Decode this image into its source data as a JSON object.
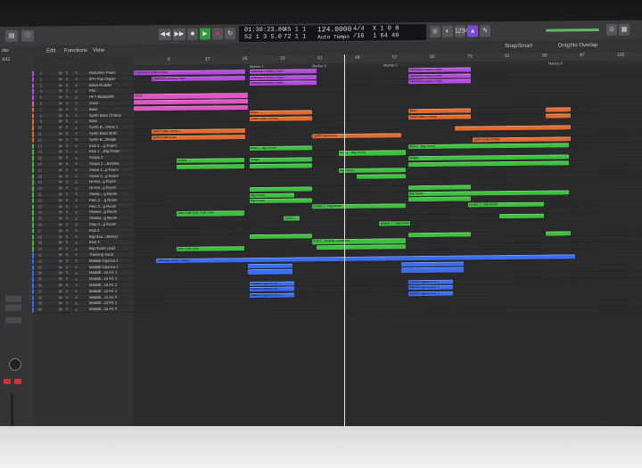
{
  "control_bar": {
    "position_time": "01:38:23.86",
    "position_bars": "52 1 3 5.0",
    "smpte_a": "45 1 1",
    "smpte_b": "72 1 1",
    "tempo": "124.0000",
    "tempo_mode": "Auto Tempo",
    "signature": "4/4",
    "division": "/16",
    "cpu": "X 1 0 0",
    "ending": "1 64 49"
  },
  "menu": {
    "edit": "Edit",
    "functions": "Functions",
    "view": "View",
    "snap_label": "Snap:",
    "snap_value": "Smart",
    "drag_label": "Drag:",
    "drag_value": "No Overlap",
    "inspector_count": "1/11",
    "inspector_label": "dits"
  },
  "ruler_ticks": [
    "9",
    "17",
    "25",
    "33",
    "41",
    "49",
    "57",
    "65",
    "73",
    "81",
    "89",
    "97",
    "105"
  ],
  "markers": [
    "Marker 1",
    "Marker 3",
    "Marker 5",
    "Marker 6"
  ],
  "tracks": [
    {
      "num": "1",
      "name": "Distortion Piano",
      "color": "#b44adf"
    },
    {
      "num": "2",
      "name": "80's Pop Organ",
      "color": "#b44adf"
    },
    {
      "num": "3",
      "name": "Black Rudder",
      "color": "#b44adf"
    },
    {
      "num": "4",
      "name": "Pan",
      "color": "#b44adf"
    },
    {
      "num": "5",
      "name": "HFY Bladsmith",
      "color": "#b44adf"
    },
    {
      "num": "6",
      "name": "Voice",
      "color": "#e055c6"
    },
    {
      "num": "7",
      "name": "Bass",
      "color": "#e36a2e"
    },
    {
      "num": "8",
      "name": "Synth Bass Chorus",
      "color": "#e36a2e"
    },
    {
      "num": "9",
      "name": "Bass",
      "color": "#e36a2e"
    },
    {
      "num": "10",
      "name": "Synth B...Verse 1",
      "color": "#e36a2e"
    },
    {
      "num": "11",
      "name": "Synth Bass BUB",
      "color": "#e36a2e"
    },
    {
      "num": "12",
      "name": "Synth B...Bridge",
      "color": "#e36a2e"
    },
    {
      "num": "13",
      "name": "Kick 2 ...g Room",
      "color": "#3fbf3f"
    },
    {
      "num": "14",
      "name": "Kick 1 ...Big Room",
      "color": "#3fbf3f"
    },
    {
      "num": "15",
      "name": "Snaps 2",
      "color": "#3fbf3f"
    },
    {
      "num": "16",
      "name": "Snaps 1 ...berlake",
      "color": "#3fbf3f"
    },
    {
      "num": "17",
      "name": "Snare 1...g Room",
      "color": "#3fbf3f"
    },
    {
      "num": "18",
      "name": "Snare 2...g Room",
      "color": "#3fbf3f"
    },
    {
      "num": "19",
      "name": "Hi-Hat...g Room",
      "color": "#3fbf3f"
    },
    {
      "num": "20",
      "name": "Hi-Hat...g Room",
      "color": "#3fbf3f"
    },
    {
      "num": "21",
      "name": "Steely-...g Room",
      "color": "#3fbf3f"
    },
    {
      "num": "22",
      "name": "Perc 1 ...g Room",
      "color": "#3fbf3f"
    },
    {
      "num": "23",
      "name": "Perc 2...g Room",
      "color": "#3fbf3f"
    },
    {
      "num": "24",
      "name": "Shaker...g Room",
      "color": "#3fbf3f"
    },
    {
      "num": "25",
      "name": "Shaker...g Room",
      "color": "#3fbf3f"
    },
    {
      "num": "26",
      "name": "Clap 2...g Room",
      "color": "#3fbf3f"
    },
    {
      "num": "27",
      "name": "Kick 2",
      "color": "#3fbf3f"
    },
    {
      "num": "28",
      "name": "Big Roo...(Merry)",
      "color": "#3fbf3f"
    },
    {
      "num": "29",
      "name": "Kick 3",
      "color": "#3fbf3f"
    },
    {
      "num": "30",
      "name": "Big Room Lead",
      "color": "#3fbf3f"
    },
    {
      "num": "31",
      "name": "Tracking Vocal",
      "color": "#3a6df0"
    },
    {
      "num": "32",
      "name": "Madalli Ogunca 2",
      "color": "#3a6df0"
    },
    {
      "num": "33",
      "name": "Madalli Ogunca 3",
      "color": "#3a6df0"
    },
    {
      "num": "34",
      "name": "Madalli...ca H1 1",
      "color": "#3a6df0"
    },
    {
      "num": "35",
      "name": "Madalli...ca H1 1",
      "color": "#3a6df0"
    },
    {
      "num": "36",
      "name": "Madalli...ca H1 1",
      "color": "#3a6df0"
    },
    {
      "num": "37",
      "name": "Madalli...ca H1 1",
      "color": "#3a6df0"
    },
    {
      "num": "38",
      "name": "Madalli...ca H1 0",
      "color": "#3a6df0"
    },
    {
      "num": "39",
      "name": "Madalli...ca H1 1",
      "color": "#3a6df0"
    },
    {
      "num": "40",
      "name": "Madalli...ca H1 0",
      "color": "#3a6df0"
    }
  ],
  "regions": [
    {
      "lane": 0,
      "start": 0,
      "len": 125,
      "label": "Distorted Electric Piano",
      "color": "#b44adf"
    },
    {
      "lane": 1,
      "start": 20,
      "len": 105,
      "label": "Distorted Electric Piano",
      "color": "#b44adf"
    },
    {
      "lane": 0,
      "start": 130,
      "len": 75,
      "label": "Distorted Electric Piano",
      "color": "#b44adf"
    },
    {
      "lane": 1,
      "start": 130,
      "len": 75,
      "label": "Distorted Electric Piano",
      "color": "#b44adf"
    },
    {
      "lane": 2,
      "start": 130,
      "len": 75,
      "label": "Distorted Electric Piano",
      "color": "#b44adf"
    },
    {
      "lane": 0,
      "start": 308,
      "len": 70,
      "label": "Distorted Electric Piano",
      "color": "#b44adf"
    },
    {
      "lane": 1,
      "start": 308,
      "len": 70,
      "label": "Distorted Electric Piano",
      "color": "#b44adf"
    },
    {
      "lane": 2,
      "start": 308,
      "len": 70,
      "label": "Distorted Electric Piano",
      "color": "#b44adf"
    },
    {
      "lane": 4,
      "start": 0,
      "len": 128,
      "label": "Voice",
      "color": "#e055c6"
    },
    {
      "lane": 5,
      "start": 0,
      "len": 128,
      "label": "",
      "color": "#e055c6"
    },
    {
      "lane": 6,
      "start": 0,
      "len": 128,
      "label": "",
      "color": "#e055c6"
    },
    {
      "lane": 7,
      "start": 130,
      "len": 70,
      "label": "Bass",
      "color": "#e36a2e"
    },
    {
      "lane": 8,
      "start": 130,
      "len": 70,
      "label": "Synth Bass Chorus",
      "color": "#e36a2e"
    },
    {
      "lane": 7,
      "start": 308,
      "len": 70,
      "label": "Bass",
      "color": "#e36a2e"
    },
    {
      "lane": 8,
      "start": 308,
      "len": 70,
      "label": "Synth Bass Chorus",
      "color": "#e36a2e"
    },
    {
      "lane": 7,
      "start": 462,
      "len": 28,
      "label": "",
      "color": "#e36a2e"
    },
    {
      "lane": 8,
      "start": 462,
      "len": 28,
      "label": "",
      "color": "#e36a2e"
    },
    {
      "lane": 10,
      "start": 20,
      "len": 105,
      "label": "Synth Bass Verse 1",
      "color": "#e36a2e"
    },
    {
      "lane": 11,
      "start": 20,
      "len": 105,
      "label": "Synth Bass BUB",
      "color": "#e36a2e"
    },
    {
      "lane": 11,
      "start": 200,
      "len": 100,
      "label": "Synth Bass BUB",
      "color": "#e36a2e"
    },
    {
      "lane": 10,
      "start": 360,
      "len": 130,
      "label": "",
      "color": "#e36a2e"
    },
    {
      "lane": 12,
      "start": 380,
      "len": 110,
      "label": "Synth Bass Bridge",
      "color": "#e36a2e"
    },
    {
      "lane": 13,
      "start": 130,
      "len": 70,
      "label": "Kick 1 - Big Room",
      "color": "#3fbf3f"
    },
    {
      "lane": 13,
      "start": 308,
      "len": 180,
      "label": "Kick 1 - Big Room",
      "color": "#3fbf3f"
    },
    {
      "lane": 14,
      "start": 230,
      "len": 75,
      "label": "Kick 1 - Big Room",
      "color": "#3fbf3f"
    },
    {
      "lane": 15,
      "start": 48,
      "len": 76,
      "label": "Snaps",
      "color": "#3fbf3f"
    },
    {
      "lane": 15,
      "start": 130,
      "len": 70,
      "label": "Snaps",
      "color": "#3fbf3f"
    },
    {
      "lane": 15,
      "start": 308,
      "len": 180,
      "label": "Snaps",
      "color": "#3fbf3f"
    },
    {
      "lane": 16,
      "start": 48,
      "len": 76,
      "label": "",
      "color": "#3fbf3f"
    },
    {
      "lane": 16,
      "start": 130,
      "len": 70,
      "label": "",
      "color": "#3fbf3f"
    },
    {
      "lane": 16,
      "start": 308,
      "len": 180,
      "label": "",
      "color": "#3fbf3f"
    },
    {
      "lane": 17,
      "start": 230,
      "len": 75,
      "label": "Big Room",
      "color": "#3fbf3f"
    },
    {
      "lane": 18,
      "start": 250,
      "len": 55,
      "label": "",
      "color": "#3fbf3f"
    },
    {
      "lane": 20,
      "start": 130,
      "len": 70,
      "label": "",
      "color": "#3fbf3f"
    },
    {
      "lane": 20,
      "start": 308,
      "len": 70,
      "label": "",
      "color": "#3fbf3f"
    },
    {
      "lane": 21,
      "start": 130,
      "len": 50,
      "label": "Big Room",
      "color": "#3fbf3f"
    },
    {
      "lane": 21,
      "start": 308,
      "len": 180,
      "label": "Big Room",
      "color": "#3fbf3f"
    },
    {
      "lane": 22,
      "start": 130,
      "len": 70,
      "label": "Big Room",
      "color": "#3fbf3f"
    },
    {
      "lane": 22,
      "start": 308,
      "len": 70,
      "label": "",
      "color": "#3fbf3f"
    },
    {
      "lane": 23,
      "start": 200,
      "len": 105,
      "label": "Hi-Hat 2 - Big Room",
      "color": "#3fbf3f"
    },
    {
      "lane": 23,
      "start": 375,
      "len": 85,
      "label": "Hi-Hat 1 - Big Room",
      "color": "#3fbf3f"
    },
    {
      "lane": 24,
      "start": 48,
      "len": 76,
      "label": "Shkr Shkr Shkr Shkr Shkr",
      "color": "#3fbf3f"
    },
    {
      "lane": 25,
      "start": 168,
      "len": 18,
      "label": "Snare 2",
      "color": "#3fbf3f"
    },
    {
      "lane": 25,
      "start": 410,
      "len": 50,
      "label": "",
      "color": "#3fbf3f"
    },
    {
      "lane": 26,
      "start": 275,
      "len": 35,
      "label": "Shaker 1 - Big Room",
      "color": "#3fbf3f"
    },
    {
      "lane": 28,
      "start": 130,
      "len": 70,
      "label": "",
      "color": "#3fbf3f"
    },
    {
      "lane": 28,
      "start": 308,
      "len": 70,
      "label": "",
      "color": "#3fbf3f"
    },
    {
      "lane": 28,
      "start": 462,
      "len": 28,
      "label": "",
      "color": "#3fbf3f"
    },
    {
      "lane": 29,
      "start": 200,
      "len": 105,
      "label": "Kick 1 - Analog Crossfeed",
      "color": "#3fbf3f"
    },
    {
      "lane": 30,
      "start": 48,
      "len": 76,
      "label": "Shkr Shkr Shkr",
      "color": "#3fbf3f"
    },
    {
      "lane": 30,
      "start": 205,
      "len": 100,
      "label": "",
      "color": "#3fbf3f"
    },
    {
      "lane": 32,
      "start": 25,
      "len": 470,
      "label": "Tracking Vocal: Comp 1",
      "color": "#3a6df0"
    },
    {
      "lane": 33,
      "start": 128,
      "len": 50,
      "label": "",
      "color": "#3a6df0"
    },
    {
      "lane": 34,
      "start": 128,
      "len": 50,
      "label": "",
      "color": "#3a6df0"
    },
    {
      "lane": 33,
      "start": 300,
      "len": 70,
      "label": "",
      "color": "#3a6df0"
    },
    {
      "lane": 34,
      "start": 300,
      "len": 70,
      "label": "",
      "color": "#3a6df0"
    },
    {
      "lane": 36,
      "start": 130,
      "len": 50,
      "label": "Madalli Ogunca H1 1",
      "color": "#3a6df0"
    },
    {
      "lane": 37,
      "start": 130,
      "len": 50,
      "label": "Madalli Ogunca H1 1",
      "color": "#3a6df0"
    },
    {
      "lane": 38,
      "start": 130,
      "len": 50,
      "label": "Madalli Ogunca H1 1",
      "color": "#3a6df0"
    },
    {
      "lane": 36,
      "start": 308,
      "len": 50,
      "label": "Madalli Ogunca H1 1",
      "color": "#3a6df0"
    },
    {
      "lane": 37,
      "start": 308,
      "len": 50,
      "label": "Madalli Ogunca H1 1",
      "color": "#3a6df0"
    },
    {
      "lane": 38,
      "start": 308,
      "len": 50,
      "label": "Madalli Ogunca H1 1",
      "color": "#3a6df0"
    }
  ]
}
